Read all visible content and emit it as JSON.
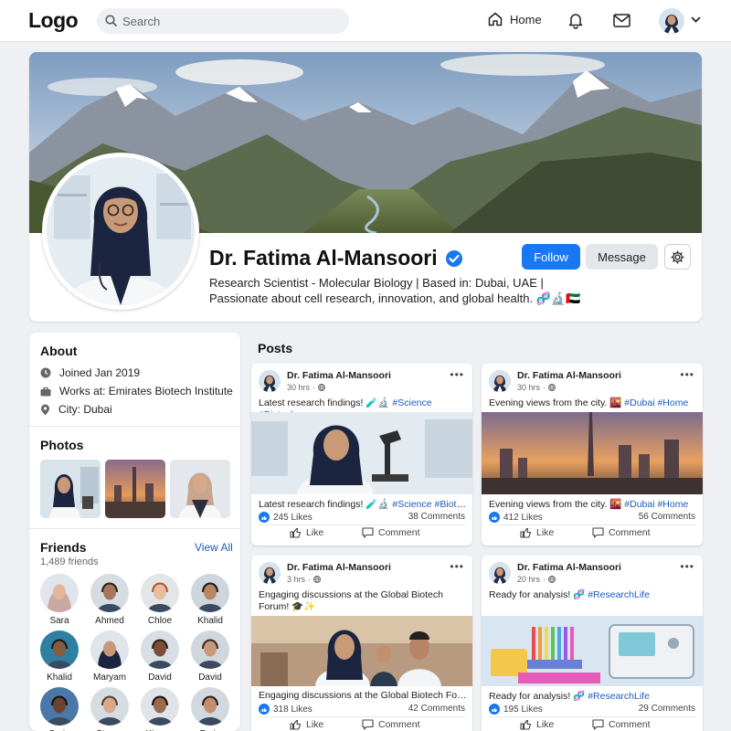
{
  "nav": {
    "logo": "Logo",
    "search_placeholder": "Search",
    "home_label": "Home"
  },
  "profile": {
    "name": "Dr. Fatima Al-Mansoori",
    "verified": true,
    "bio_line1": "Research Scientist - Molecular Biology | Based in: Dubai, UAE |",
    "bio_line2": "Passionate about cell research, innovation, and global health. 🧬🔬🇦🇪",
    "follow_label": "Follow",
    "message_label": "Message"
  },
  "about": {
    "title": "About",
    "items": [
      {
        "icon": "clock-icon",
        "text": "Joined Jan 2019"
      },
      {
        "icon": "briefcase-icon",
        "text": "Works at: Emirates Biotech Institute"
      },
      {
        "icon": "location-pin-icon",
        "text": "City: Dubai"
      }
    ]
  },
  "photos": {
    "title": "Photos",
    "items": [
      "lab scientist",
      "Dubai skyline",
      "woman in lab coat"
    ]
  },
  "friends": {
    "title": "Friends",
    "count": "1,489 friends",
    "view_all": "View All",
    "list": [
      "Sara",
      "Ahmed",
      "Chloe",
      "Khalid",
      "Khalid",
      "Maryam",
      "David",
      "David",
      "Saria",
      "Steron",
      "Kionee",
      "Farin"
    ]
  },
  "posts": {
    "title": "Posts",
    "items": [
      {
        "author": "Dr. Fatima Al-Mansoori",
        "time": "30 hrs",
        "caption_text": "Latest research findings! 🧪🔬",
        "caption_tags": "#Science #Biotech",
        "caption2_text": "Latest research findings! 🧪🔬",
        "caption2_tags": "#Science #Biotech",
        "likes": "245 Likes",
        "comments": "38 Comments",
        "like_label": "Like",
        "comment_label": "Comment"
      },
      {
        "author": "Dr. Fatima Al-Mansoori",
        "time": "30 hrs",
        "caption_text": "Evening views from the city. 🌇",
        "caption_tags": "#Dubai #Home",
        "caption2_text": "Evening views from the city. 🌇",
        "caption2_tags": "#Dubai #Home",
        "likes": "412 Likes",
        "comments": "56 Comments",
        "like_label": "Like",
        "comment_label": "Comment"
      },
      {
        "author": "Dr. Fatima Al-Mansoori",
        "time": "3 hrs",
        "caption_text": "Engaging discussions at the Global Biotech Forum! 🎓✨",
        "caption_tags": "",
        "caption2_text": "Engaging discussions at the Global Biotech For...",
        "caption2_tags": "",
        "likes": "318 Likes",
        "comments": "42 Comments",
        "like_label": "Like",
        "comment_label": "Comment"
      },
      {
        "author": "Dr. Fatima Al-Mansoori",
        "time": "20 hrs",
        "caption_text": "Ready for analysis! 🧬",
        "caption_tags": "#ResearchLife",
        "caption2_text": "Ready for analysis! 🧬",
        "caption2_tags": "#ResearchLife",
        "likes": "195 Likes",
        "comments": "29 Comments",
        "like_label": "Like",
        "comment_label": "Comment"
      }
    ]
  },
  "colors": {
    "accent": "#1877f2",
    "hashtag": "#1d5bbf",
    "background": "#eef0f3"
  }
}
